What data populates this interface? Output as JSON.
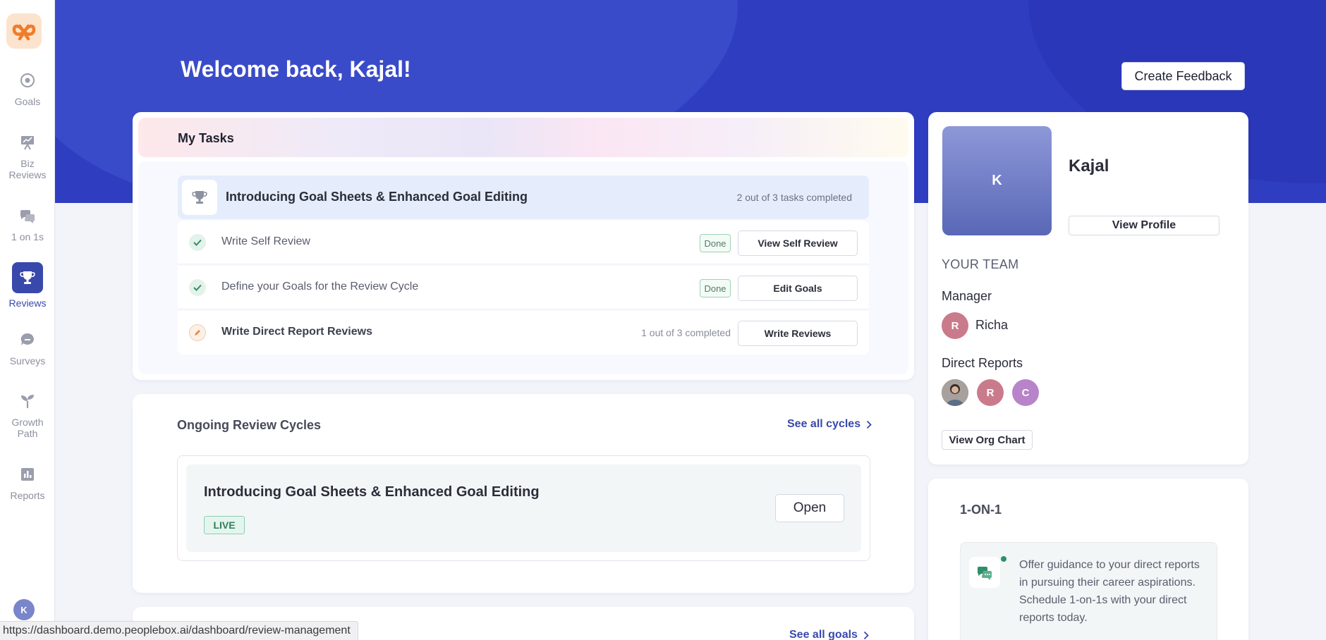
{
  "sidebar": {
    "items": [
      {
        "label": "Goals",
        "icon": "target-icon"
      },
      {
        "label": "Biz\nReviews",
        "icon": "presentation-icon"
      },
      {
        "label": "1 on 1s",
        "icon": "chat-bubbles-icon"
      },
      {
        "label": "Reviews",
        "icon": "trophy-icon",
        "active": true
      },
      {
        "label": "Surveys",
        "icon": "speech-bubble-icon"
      },
      {
        "label": "Growth\nPath",
        "icon": "sprout-icon"
      },
      {
        "label": "Reports",
        "icon": "bar-chart-icon"
      }
    ],
    "user_initial": "K"
  },
  "header": {
    "welcome": "Welcome back, Kajal!",
    "create_feedback": "Create Feedback"
  },
  "tasks": {
    "title": "My Tasks",
    "cycle_name": "Introducing Goal Sheets & Enhanced Goal Editing",
    "cycle_progress": "2 out of 3 tasks completed",
    "items": [
      {
        "label": "Write Self Review",
        "status": "Done",
        "button": "View Self Review"
      },
      {
        "label": "Define your Goals for the Review Cycle",
        "status": "Done",
        "button": "Edit Goals"
      },
      {
        "label": "Write Direct Report Reviews",
        "count": "1 out of 3 completed",
        "button": "Write Reviews"
      }
    ]
  },
  "ongoing": {
    "title": "Ongoing Review Cycles",
    "see_all": "See all cycles",
    "cycle_name": "Introducing Goal Sheets & Enhanced Goal Editing",
    "status": "LIVE",
    "open": "Open"
  },
  "goals": {
    "see_all": "See all goals"
  },
  "profile": {
    "initial": "K",
    "name": "Kajal",
    "view_profile": "View Profile",
    "team_heading": "YOUR TEAM",
    "manager_heading": "Manager",
    "manager": {
      "initial": "R",
      "name": "Richa"
    },
    "direct_reports_heading": "Direct Reports",
    "direct_reports": [
      {
        "initial": "",
        "type": "photo"
      },
      {
        "initial": "R",
        "color": "#c97b8c"
      },
      {
        "initial": "C",
        "color": "#b784c9"
      }
    ],
    "org_chart": "View Org Chart"
  },
  "oneonone": {
    "title": "1-ON-1",
    "text": "Offer guidance to your direct reports in pursuing their career aspirations.",
    "text2": "Schedule 1-on-1s with your direct reports today."
  },
  "status_bar": {
    "url": "https://dashboard.demo.peoplebox.ai/dashboard/review-management"
  },
  "colors": {
    "brand": "#3949ab",
    "hero": "#2f3ec0",
    "success": "#2f8f6a"
  }
}
